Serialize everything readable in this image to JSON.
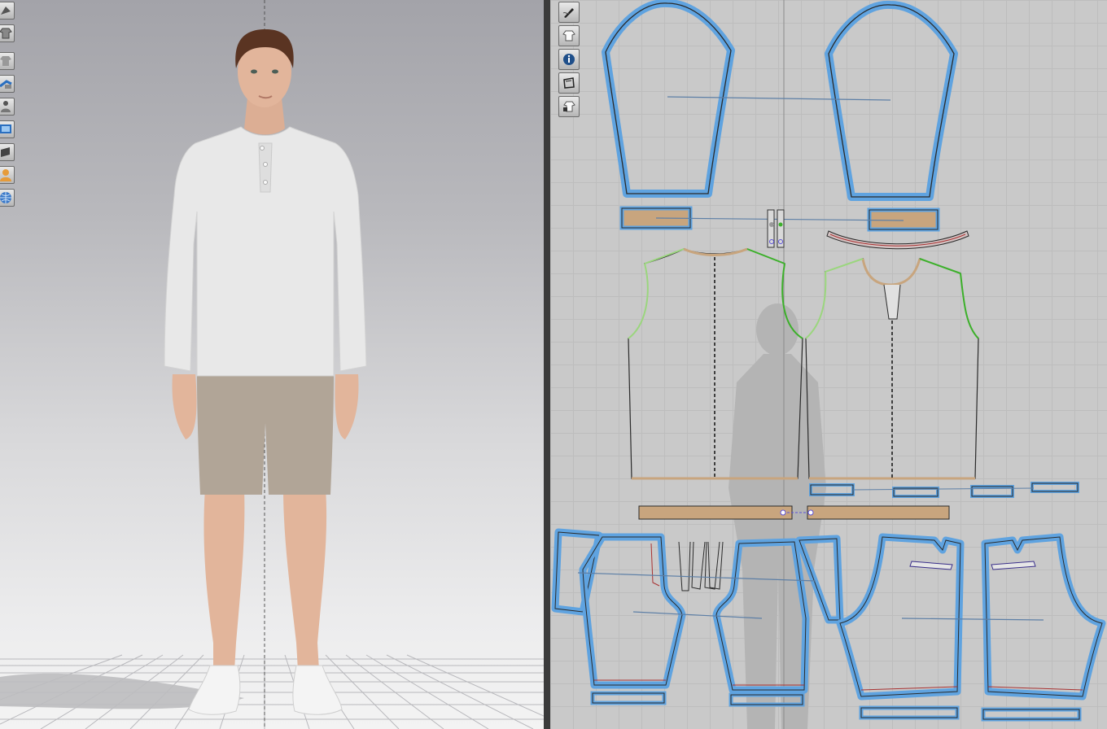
{
  "app": {
    "panes": [
      "3d-garment-view",
      "2d-pattern-view"
    ]
  },
  "toolbar_3d": {
    "tools": [
      {
        "name": "simulation-icon"
      },
      {
        "name": "garment-icon"
      },
      {
        "name": "show-garment-icon"
      },
      {
        "name": "fold-arrangement-icon"
      },
      {
        "name": "show-avatar-icon"
      },
      {
        "name": "texture-view-icon"
      },
      {
        "name": "arrangement-plane-icon"
      },
      {
        "name": "avatar-icon"
      },
      {
        "name": "environment-icon"
      }
    ]
  },
  "toolbar_2d": {
    "tools": [
      {
        "name": "pen-tool-icon"
      },
      {
        "name": "show-pattern-icon"
      },
      {
        "name": "info-icon"
      },
      {
        "name": "pattern-outline-icon"
      },
      {
        "name": "lock-garment-icon"
      }
    ]
  },
  "colors": {
    "pattern_selected": "#5fa3e0",
    "pattern_line": "#2a2a2a",
    "binding_fill": "#c8a57e",
    "sewing_line": "#5d7fa6",
    "seam_green": "#3cb02a",
    "grid_bg": "#c9c9c9",
    "shirt": "#e8e8e8",
    "shorts": "#b1a597",
    "skin": "#e0b49a",
    "hair": "#5a3422"
  }
}
